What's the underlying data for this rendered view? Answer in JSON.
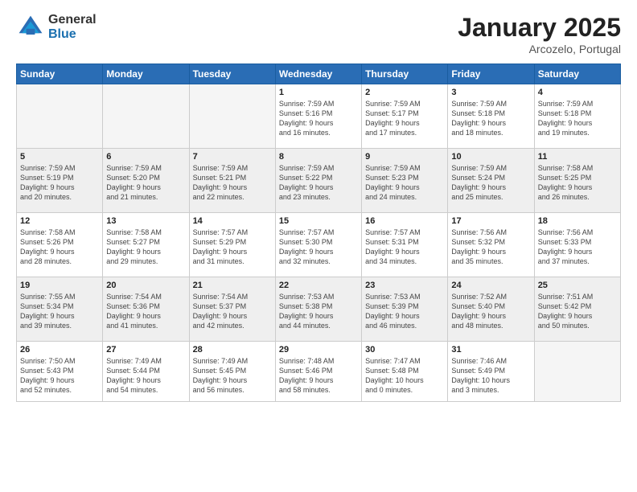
{
  "header": {
    "logo_general": "General",
    "logo_blue": "Blue",
    "month_title": "January 2025",
    "location": "Arcozelo, Portugal"
  },
  "days_of_week": [
    "Sunday",
    "Monday",
    "Tuesday",
    "Wednesday",
    "Thursday",
    "Friday",
    "Saturday"
  ],
  "weeks": [
    [
      {
        "day": "",
        "info": ""
      },
      {
        "day": "",
        "info": ""
      },
      {
        "day": "",
        "info": ""
      },
      {
        "day": "1",
        "info": "Sunrise: 7:59 AM\nSunset: 5:16 PM\nDaylight: 9 hours\nand 16 minutes."
      },
      {
        "day": "2",
        "info": "Sunrise: 7:59 AM\nSunset: 5:17 PM\nDaylight: 9 hours\nand 17 minutes."
      },
      {
        "day": "3",
        "info": "Sunrise: 7:59 AM\nSunset: 5:18 PM\nDaylight: 9 hours\nand 18 minutes."
      },
      {
        "day": "4",
        "info": "Sunrise: 7:59 AM\nSunset: 5:18 PM\nDaylight: 9 hours\nand 19 minutes."
      }
    ],
    [
      {
        "day": "5",
        "info": "Sunrise: 7:59 AM\nSunset: 5:19 PM\nDaylight: 9 hours\nand 20 minutes."
      },
      {
        "day": "6",
        "info": "Sunrise: 7:59 AM\nSunset: 5:20 PM\nDaylight: 9 hours\nand 21 minutes."
      },
      {
        "day": "7",
        "info": "Sunrise: 7:59 AM\nSunset: 5:21 PM\nDaylight: 9 hours\nand 22 minutes."
      },
      {
        "day": "8",
        "info": "Sunrise: 7:59 AM\nSunset: 5:22 PM\nDaylight: 9 hours\nand 23 minutes."
      },
      {
        "day": "9",
        "info": "Sunrise: 7:59 AM\nSunset: 5:23 PM\nDaylight: 9 hours\nand 24 minutes."
      },
      {
        "day": "10",
        "info": "Sunrise: 7:59 AM\nSunset: 5:24 PM\nDaylight: 9 hours\nand 25 minutes."
      },
      {
        "day": "11",
        "info": "Sunrise: 7:58 AM\nSunset: 5:25 PM\nDaylight: 9 hours\nand 26 minutes."
      }
    ],
    [
      {
        "day": "12",
        "info": "Sunrise: 7:58 AM\nSunset: 5:26 PM\nDaylight: 9 hours\nand 28 minutes."
      },
      {
        "day": "13",
        "info": "Sunrise: 7:58 AM\nSunset: 5:27 PM\nDaylight: 9 hours\nand 29 minutes."
      },
      {
        "day": "14",
        "info": "Sunrise: 7:57 AM\nSunset: 5:29 PM\nDaylight: 9 hours\nand 31 minutes."
      },
      {
        "day": "15",
        "info": "Sunrise: 7:57 AM\nSunset: 5:30 PM\nDaylight: 9 hours\nand 32 minutes."
      },
      {
        "day": "16",
        "info": "Sunrise: 7:57 AM\nSunset: 5:31 PM\nDaylight: 9 hours\nand 34 minutes."
      },
      {
        "day": "17",
        "info": "Sunrise: 7:56 AM\nSunset: 5:32 PM\nDaylight: 9 hours\nand 35 minutes."
      },
      {
        "day": "18",
        "info": "Sunrise: 7:56 AM\nSunset: 5:33 PM\nDaylight: 9 hours\nand 37 minutes."
      }
    ],
    [
      {
        "day": "19",
        "info": "Sunrise: 7:55 AM\nSunset: 5:34 PM\nDaylight: 9 hours\nand 39 minutes."
      },
      {
        "day": "20",
        "info": "Sunrise: 7:54 AM\nSunset: 5:36 PM\nDaylight: 9 hours\nand 41 minutes."
      },
      {
        "day": "21",
        "info": "Sunrise: 7:54 AM\nSunset: 5:37 PM\nDaylight: 9 hours\nand 42 minutes."
      },
      {
        "day": "22",
        "info": "Sunrise: 7:53 AM\nSunset: 5:38 PM\nDaylight: 9 hours\nand 44 minutes."
      },
      {
        "day": "23",
        "info": "Sunrise: 7:53 AM\nSunset: 5:39 PM\nDaylight: 9 hours\nand 46 minutes."
      },
      {
        "day": "24",
        "info": "Sunrise: 7:52 AM\nSunset: 5:40 PM\nDaylight: 9 hours\nand 48 minutes."
      },
      {
        "day": "25",
        "info": "Sunrise: 7:51 AM\nSunset: 5:42 PM\nDaylight: 9 hours\nand 50 minutes."
      }
    ],
    [
      {
        "day": "26",
        "info": "Sunrise: 7:50 AM\nSunset: 5:43 PM\nDaylight: 9 hours\nand 52 minutes."
      },
      {
        "day": "27",
        "info": "Sunrise: 7:49 AM\nSunset: 5:44 PM\nDaylight: 9 hours\nand 54 minutes."
      },
      {
        "day": "28",
        "info": "Sunrise: 7:49 AM\nSunset: 5:45 PM\nDaylight: 9 hours\nand 56 minutes."
      },
      {
        "day": "29",
        "info": "Sunrise: 7:48 AM\nSunset: 5:46 PM\nDaylight: 9 hours\nand 58 minutes."
      },
      {
        "day": "30",
        "info": "Sunrise: 7:47 AM\nSunset: 5:48 PM\nDaylight: 10 hours\nand 0 minutes."
      },
      {
        "day": "31",
        "info": "Sunrise: 7:46 AM\nSunset: 5:49 PM\nDaylight: 10 hours\nand 3 minutes."
      },
      {
        "day": "",
        "info": ""
      }
    ]
  ]
}
